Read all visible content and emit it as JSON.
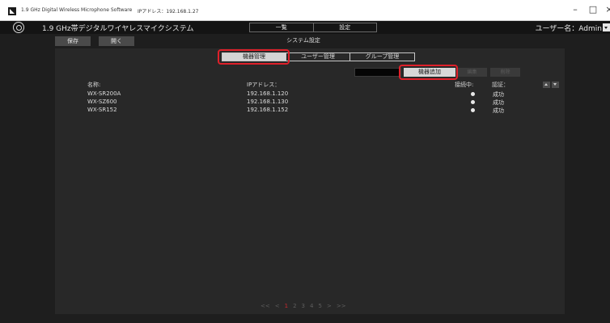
{
  "window": {
    "title": "1.9 GHz Digital Wireless Microphone Software",
    "ip": "IPアドレス：192.168.1.27",
    "minimize": "–",
    "maximize": "□",
    "close": "×"
  },
  "header": {
    "app_title": "1.9 GHz帯デジタルワイヤレスマイクシステム",
    "nav": [
      "一覧",
      "設定"
    ],
    "user": "ユーザー名：Admin"
  },
  "toolbar": {
    "save_label": "保存",
    "open_label": "開く",
    "section_title": "システム設定"
  },
  "tabs": [
    {
      "label": "機器管理",
      "active": true
    },
    {
      "label": "ユーザー管理",
      "active": false
    },
    {
      "label": "グループ管理",
      "active": false
    }
  ],
  "actions": {
    "add_label": "機器追加",
    "edit_label": "編集",
    "delete_label": "削除",
    "search_value": ""
  },
  "columns": {
    "name": "名称:",
    "ip": "IPアドレス：",
    "connected": "接続中:",
    "auth": "認証："
  },
  "devices": [
    {
      "name": "WX-SR200A",
      "ip": "192.168.1.120",
      "auth": "成功"
    },
    {
      "name": "WX-SZ600",
      "ip": "192.168.1.130",
      "auth": "成功"
    },
    {
      "name": "WX-SR152",
      "ip": "192.168.1.152",
      "auth": "成功"
    }
  ],
  "pager": {
    "first": "<<",
    "prev": "<",
    "pages": [
      "1",
      "2",
      "3",
      "4",
      "5"
    ],
    "current": "1",
    "next": ">",
    "last": ">>"
  },
  "colors": {
    "highlight": "#e0202a",
    "background": "#1e1e1e",
    "panel": "#282828",
    "current_page": "#c8282f"
  }
}
